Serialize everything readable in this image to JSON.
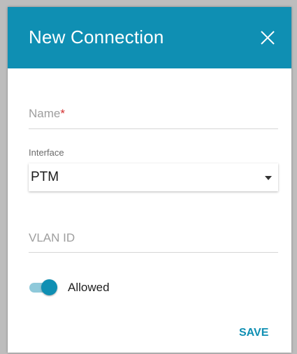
{
  "dialog": {
    "title": "New Connection",
    "close_icon": "close-icon"
  },
  "form": {
    "name": {
      "label": "Name",
      "required_marker": "*",
      "value": ""
    },
    "interface": {
      "label": "Interface",
      "value": "PTM",
      "icon": "caret-down-icon"
    },
    "vlan_id": {
      "label": "VLAN ID",
      "value": ""
    },
    "allowed": {
      "label": "Allowed",
      "checked": true
    }
  },
  "actions": {
    "save_label": "SAVE"
  },
  "colors": {
    "accent": "#0f8fb3",
    "required": "#d32f2f",
    "toggle_track": "#8fc9da"
  }
}
